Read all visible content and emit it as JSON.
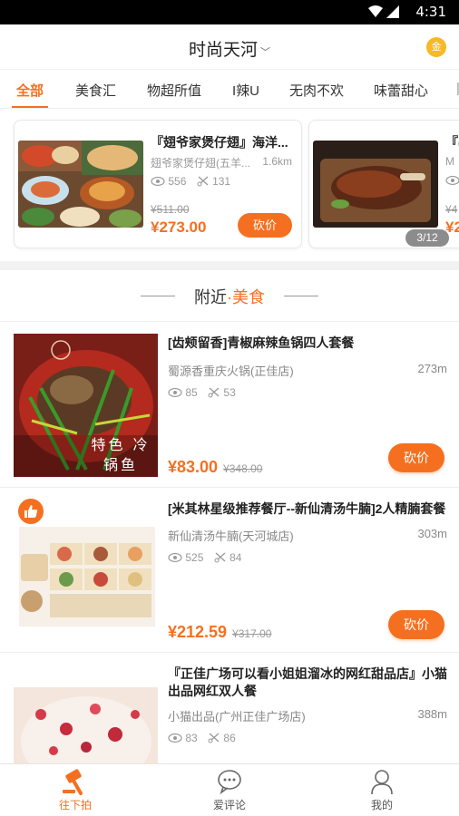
{
  "status_bar": {
    "time": "4:31"
  },
  "header": {
    "city": "时尚天河",
    "coin_label": "金"
  },
  "tabs": [
    "全部",
    "美食汇",
    "物超所值",
    "I辣U",
    "无肉不欢",
    "味蕾甜心"
  ],
  "carousel": {
    "cards": [
      {
        "title": "『翅爷家煲仔翅』海洋...",
        "shop": "翅爷家煲仔翅(五羊...",
        "distance": "1.6km",
        "views": "556",
        "claims": "131",
        "original_price": "¥511.00",
        "price": "¥273.00",
        "button": "砍价"
      },
      {
        "title": "『(",
        "shop": "M",
        "views": "4",
        "original_price": "¥4",
        "price": "¥2"
      }
    ],
    "pager": "3/12"
  },
  "section": {
    "title_prefix": "附近",
    "dot": "·",
    "title_highlight": "美食"
  },
  "list": [
    {
      "name": "[齿颊留香]青椒麻辣鱼锅四人套餐",
      "shop": "蜀源香重庆火锅(正佳店)",
      "distance": "273m",
      "views": "85",
      "claims": "53",
      "price": "¥83.00",
      "original_price": "¥348.00",
      "button": "砍价",
      "img_caption": "特色 冷锅鱼"
    },
    {
      "name": "[米其林星级推荐餐厅--新仙清汤牛腩]2人精腩套餐",
      "shop": "新仙清汤牛腩(天河城店)",
      "distance": "303m",
      "views": "525",
      "claims": "84",
      "price": "¥212.59",
      "original_price": "¥317.00",
      "button": "砍价"
    },
    {
      "name": "『正佳广场可以看小姐姐溜冰的网红甜品店』小猫出品网红双人餐",
      "shop": "小猫出品(广州正佳广场店)",
      "distance": "388m",
      "views": "83",
      "claims": "86"
    }
  ],
  "bottom_nav": [
    {
      "label": "往下拍"
    },
    {
      "label": "爱评论"
    },
    {
      "label": "我的"
    }
  ],
  "colors": {
    "accent": "#f47020"
  }
}
